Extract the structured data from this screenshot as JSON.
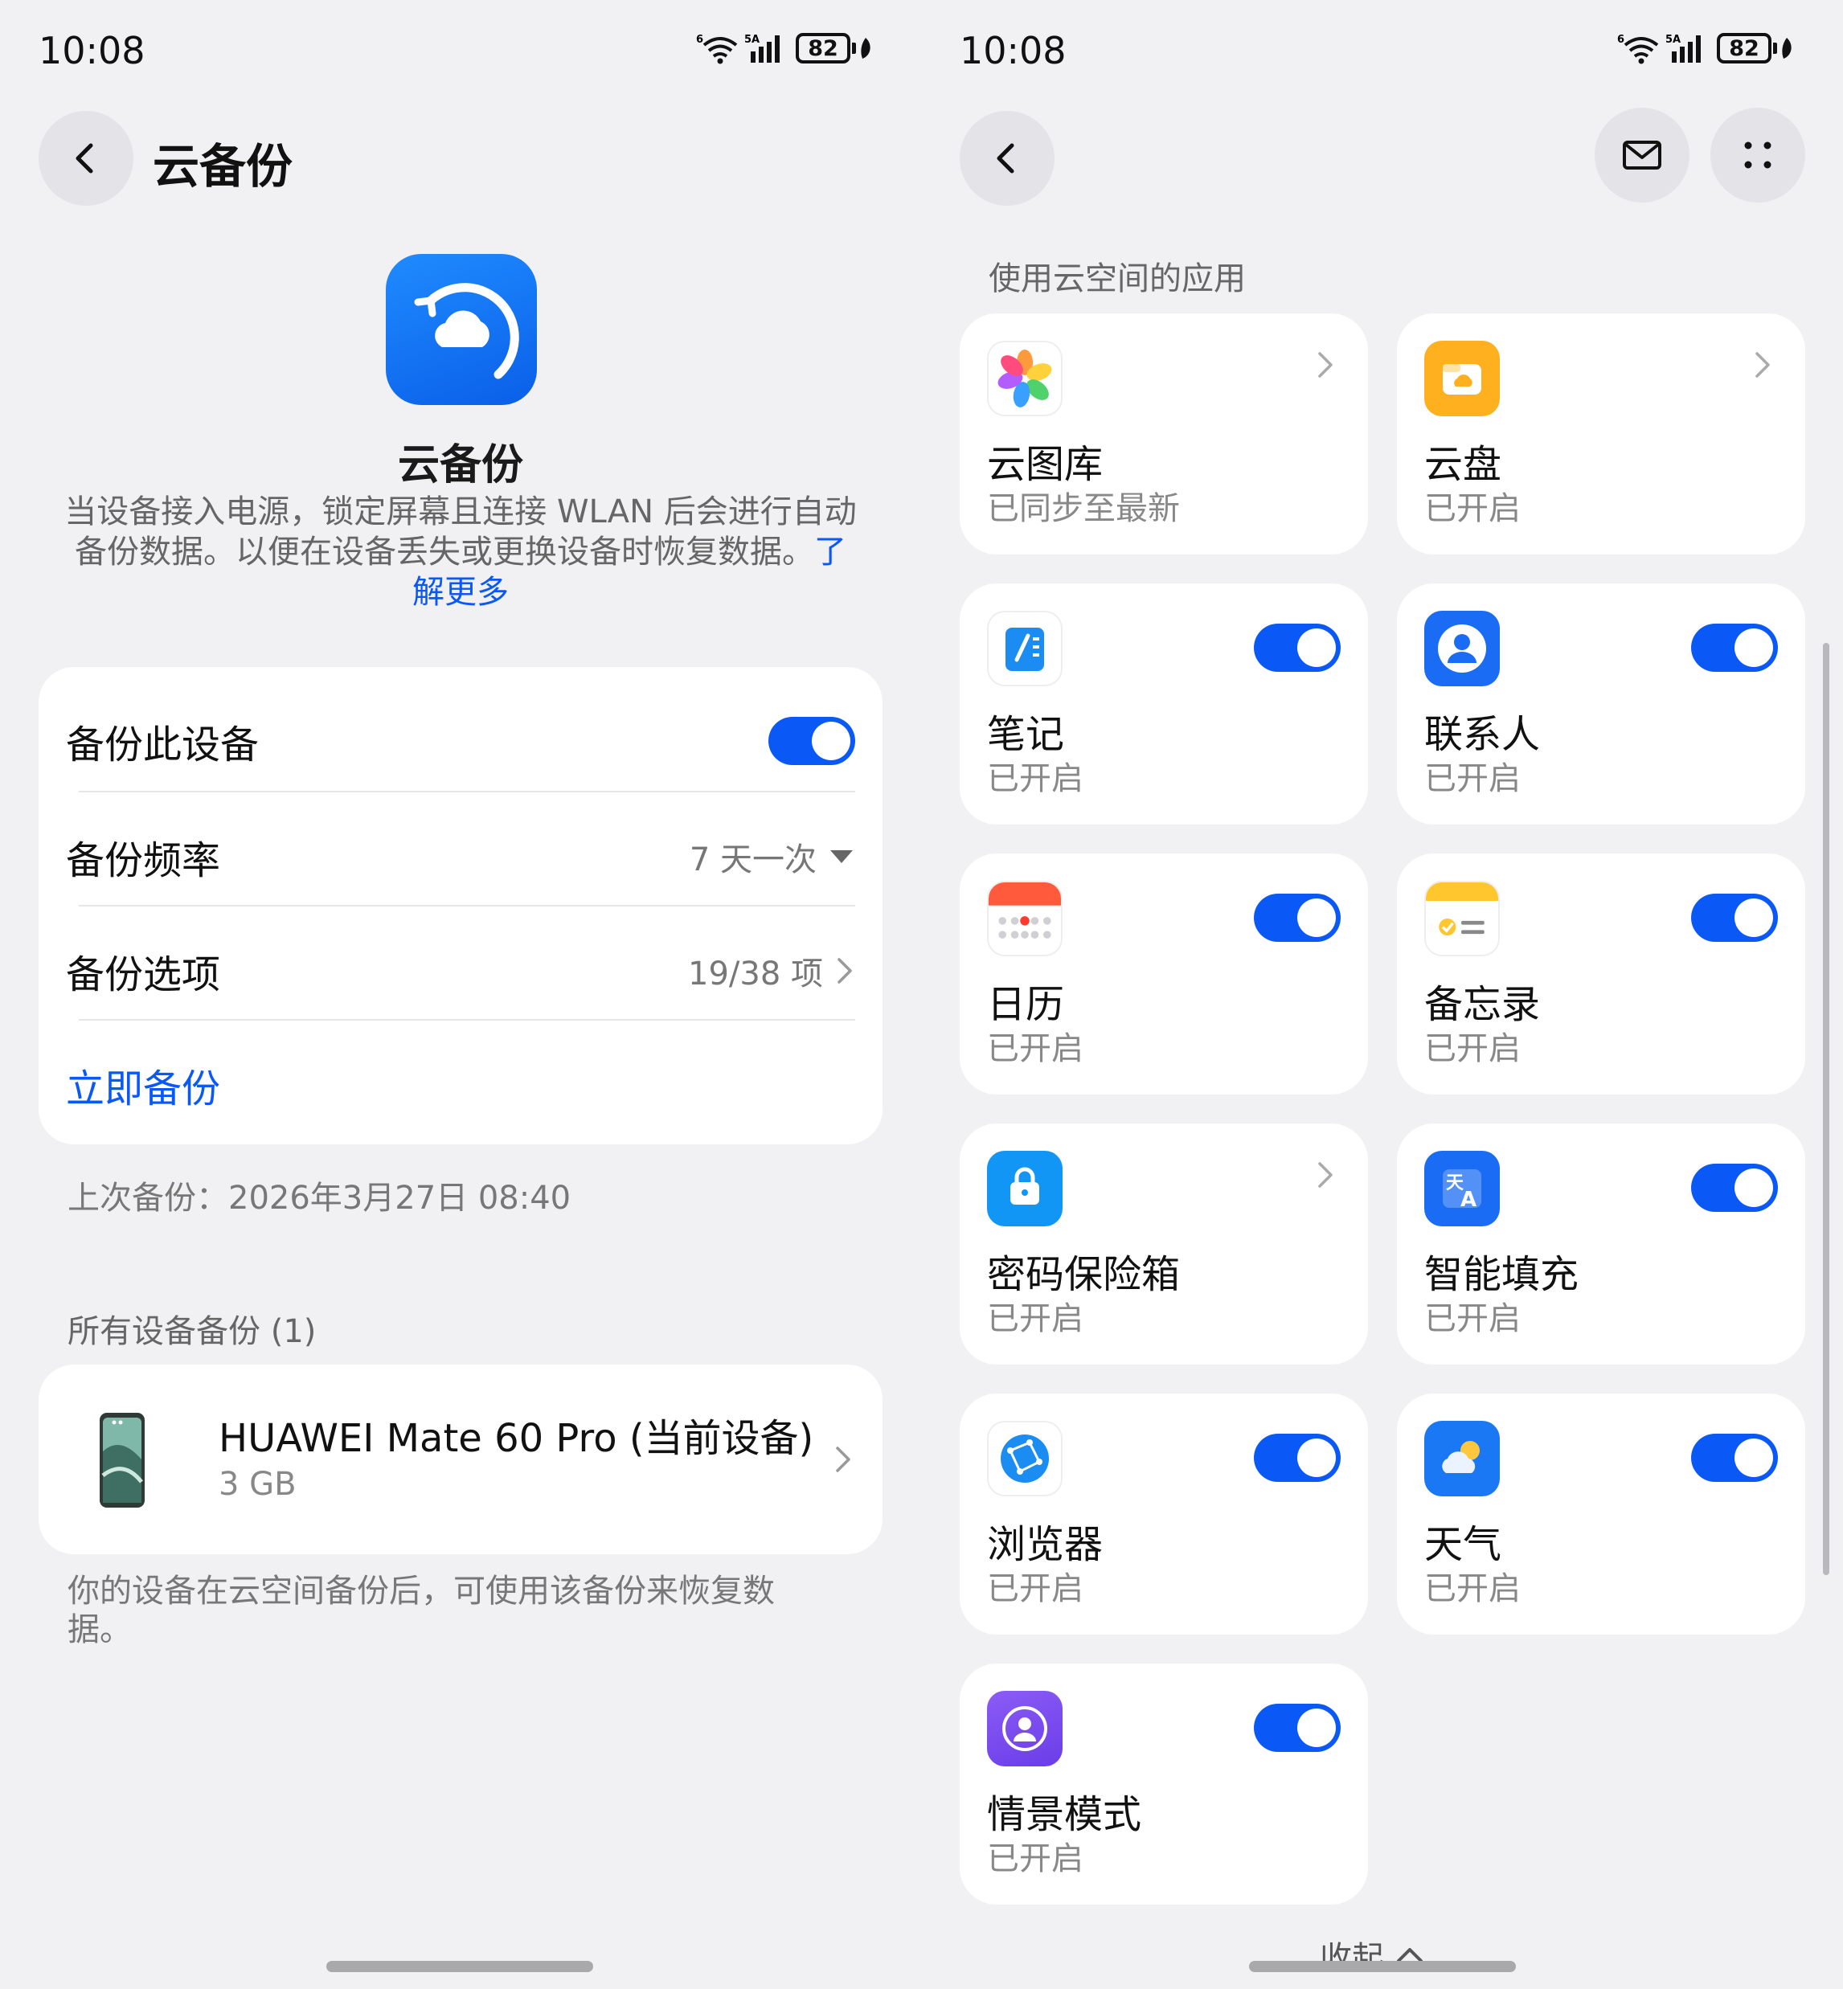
{
  "status": {
    "time": "10:08",
    "battery": "82"
  },
  "left": {
    "header_title": "云备份",
    "app_name": "云备份",
    "app_desc": "当设备接入电源，锁定屏幕且连接 WLAN 后会进行自动备份数据。以便在设备丢失或更换设备时恢复数据。",
    "learn_more": "了解更多",
    "backup_device_label": "备份此设备",
    "backup_freq_label": "备份频率",
    "backup_freq_value": "7 天一次",
    "backup_options_label": "备份选项",
    "backup_options_value": "19/38 项",
    "backup_now": "立即备份",
    "last_backup": "上次备份：2026年3月27日 08:40",
    "all_devices_header": "所有设备备份 (1)",
    "device_name": "HUAWEI Mate 60 Pro (当前设备)",
    "device_size": "3 GB",
    "footer_note": "你的设备在云空间备份后，可使用该备份来恢复数据。"
  },
  "right": {
    "section_header": "使用云空间的应用",
    "apps": [
      {
        "name": "云图库",
        "status": "已同步至最新",
        "control": "chevron",
        "icon": "gallery-icon"
      },
      {
        "name": "云盘",
        "status": "已开启",
        "control": "chevron",
        "icon": "cloud-drive-icon"
      },
      {
        "name": "笔记",
        "status": "已开启",
        "control": "toggle",
        "icon": "notes-icon"
      },
      {
        "name": "联系人",
        "status": "已开启",
        "control": "toggle",
        "icon": "contacts-icon"
      },
      {
        "name": "日历",
        "status": "已开启",
        "control": "toggle",
        "icon": "calendar-icon"
      },
      {
        "name": "备忘录",
        "status": "已开启",
        "control": "toggle",
        "icon": "memo-icon"
      },
      {
        "name": "密码保险箱",
        "status": "已开启",
        "control": "chevron",
        "icon": "password-vault-icon"
      },
      {
        "name": "智能填充",
        "status": "已开启",
        "control": "toggle",
        "icon": "autofill-icon"
      },
      {
        "name": "浏览器",
        "status": "已开启",
        "control": "toggle",
        "icon": "browser-icon"
      },
      {
        "name": "天气",
        "status": "已开启",
        "control": "toggle",
        "icon": "weather-icon"
      },
      {
        "name": "情景模式",
        "status": "已开启",
        "control": "toggle",
        "icon": "scenario-mode-icon"
      }
    ],
    "collapse_label": "收起"
  },
  "colors": {
    "accent": "#0a59f7",
    "background": "#f1f1f4",
    "card": "#ffffff"
  }
}
